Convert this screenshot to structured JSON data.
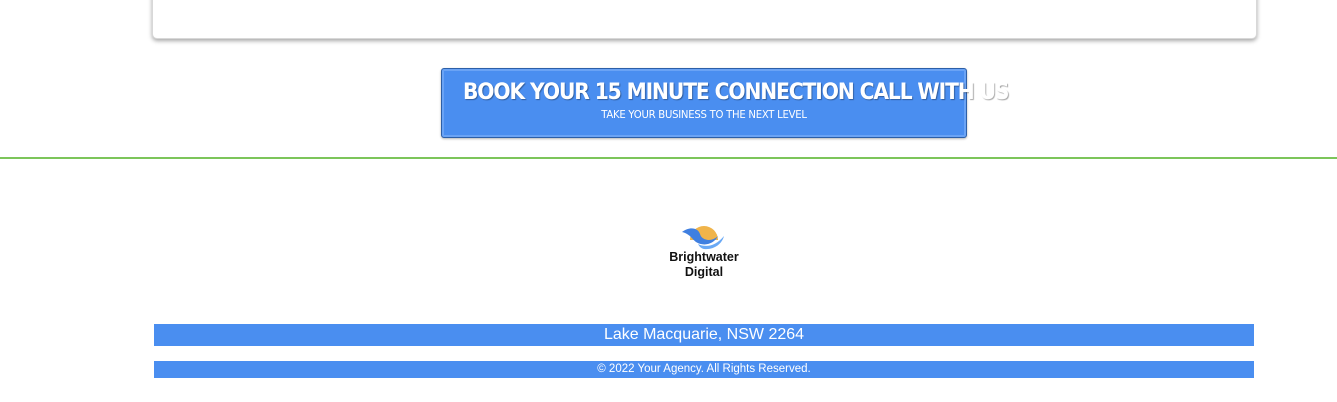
{
  "cta": {
    "title": "BOOK YOUR 15 MINUTE CONNECTION CALL WITH US",
    "subtitle": "TAKE YOUR BUSINESS TO THE NEXT LEVEL"
  },
  "logo": {
    "line1": "Brightwater",
    "line2": "Digital",
    "icon": "sun-wave-icon"
  },
  "footer": {
    "address": "Lake Macquarie, NSW 2264",
    "copyright": "© 2022 Your Agency. All Rights Reserved."
  },
  "colors": {
    "accent": "#4a8ef0",
    "divider": "#7cc55a",
    "sun": "#f0b44a",
    "wave": "#4a8ef0"
  }
}
